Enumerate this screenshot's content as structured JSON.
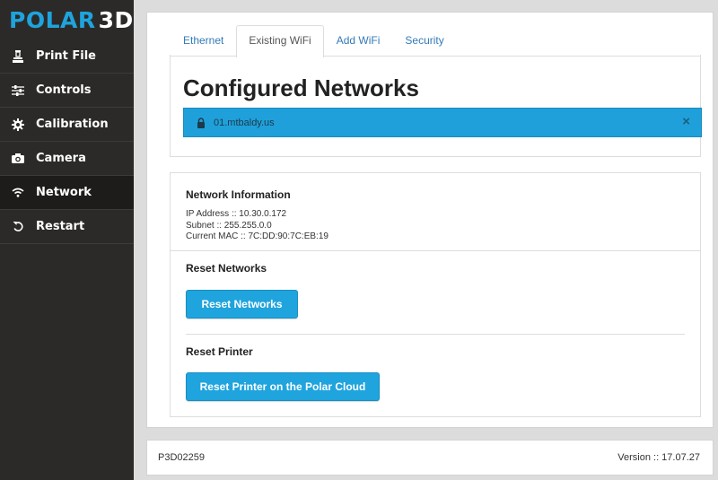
{
  "brand": {
    "part1": "POLAR",
    "part2": "3D"
  },
  "sidebar": {
    "items": [
      {
        "label": "Print File",
        "icon": "printer-icon"
      },
      {
        "label": "Controls",
        "icon": "sliders-icon"
      },
      {
        "label": "Calibration",
        "icon": "gear-icon"
      },
      {
        "label": "Camera",
        "icon": "camera-icon"
      },
      {
        "label": "Network",
        "icon": "wifi-icon",
        "active": true
      },
      {
        "label": "Restart",
        "icon": "restart-icon"
      }
    ]
  },
  "tabs": [
    {
      "label": "Ethernet"
    },
    {
      "label": "Existing WiFi",
      "active": true
    },
    {
      "label": "Add WiFi"
    },
    {
      "label": "Security"
    }
  ],
  "configured": {
    "title": "Configured Networks",
    "networks": [
      {
        "name": "01.mtbaldy.us"
      }
    ],
    "close_symbol": "×"
  },
  "network_info": {
    "title": "Network Information",
    "ip": "IP Address :: 10.30.0.172",
    "subnet": "Subnet :: 255.255.0.0",
    "mac": "Current MAC :: 7C:DD:90:7C:EB:19"
  },
  "reset_networks": {
    "title": "Reset Networks",
    "button": "Reset Networks"
  },
  "reset_printer": {
    "title": "Reset Printer",
    "button": "Reset Printer on the Polar Cloud"
  },
  "footer": {
    "serial": "P3D02259",
    "version": "Version :: 17.07.27"
  },
  "colors": {
    "accent": "#1fa4de",
    "sidebar_bg": "#2b2a28",
    "link": "#337ab7"
  }
}
